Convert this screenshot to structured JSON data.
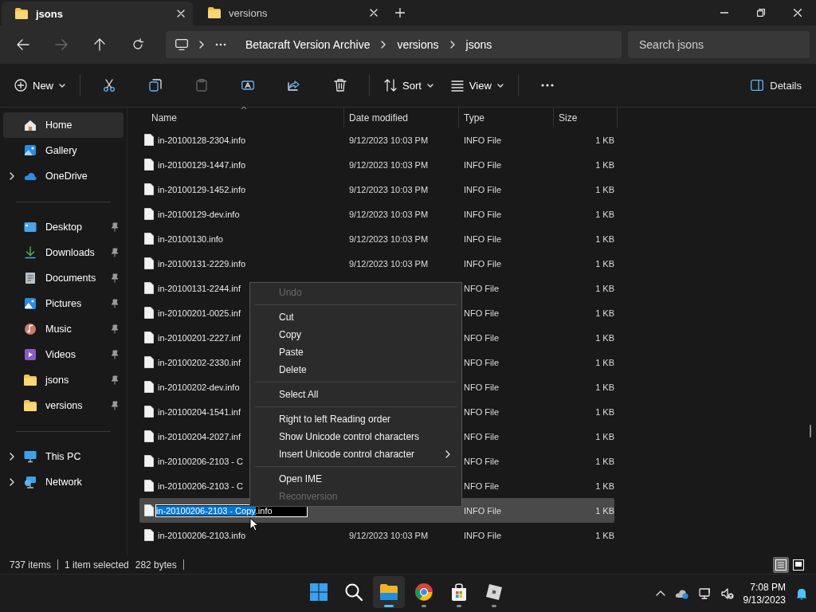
{
  "tabs": [
    {
      "label": "jsons",
      "selected": true
    },
    {
      "label": "versions",
      "selected": false
    }
  ],
  "address_bar": {
    "breadcrumbs": [
      "Betacraft Version Archive",
      "versions",
      "jsons"
    ],
    "search": {
      "placeholder": "Search jsons"
    }
  },
  "toolbar": {
    "items": [
      {
        "kind": "button",
        "label": "New",
        "dropdown": true,
        "disabled": false
      },
      {
        "kind": "separator"
      },
      {
        "kind": "button",
        "disabled": false
      },
      {
        "kind": "button",
        "disabled": false
      },
      {
        "kind": "button",
        "disabled": true
      },
      {
        "kind": "button",
        "disabled": false
      },
      {
        "kind": "button",
        "disabled": false
      },
      {
        "kind": "button",
        "disabled": false
      },
      {
        "kind": "separator"
      },
      {
        "kind": "button",
        "label": "Sort",
        "dropdown": true,
        "disabled": false
      },
      {
        "kind": "button",
        "label": "View",
        "dropdown": true,
        "disabled": false
      },
      {
        "kind": "separator"
      },
      {
        "kind": "button",
        "disabled": false
      }
    ],
    "details_button": {
      "label": "Details"
    }
  },
  "sidebar": {
    "groups": [
      [
        {
          "label": "Home",
          "kind": "plain",
          "selected": true
        },
        {
          "label": "Gallery",
          "kind": "plain",
          "selected": false
        },
        {
          "label": "OneDrive",
          "kind": "expandable",
          "selected": false
        }
      ],
      [
        {
          "label": "Desktop",
          "kind": "pinned",
          "selected": false
        },
        {
          "label": "Downloads",
          "kind": "pinned",
          "selected": false
        },
        {
          "label": "Documents",
          "kind": "pinned",
          "selected": false
        },
        {
          "label": "Pictures",
          "kind": "pinned",
          "selected": false
        },
        {
          "label": "Music",
          "kind": "pinned",
          "selected": false
        },
        {
          "label": "Videos",
          "kind": "pinned",
          "selected": false
        },
        {
          "label": "jsons",
          "kind": "pinned",
          "selected": false
        },
        {
          "label": "versions",
          "kind": "pinned",
          "selected": false
        }
      ],
      [
        {
          "label": "This PC",
          "kind": "expandable",
          "selected": false
        },
        {
          "label": "Network",
          "kind": "expandable",
          "selected": false
        }
      ]
    ]
  },
  "file_list": {
    "columns": [
      "Name",
      "Date modified",
      "Type",
      "Size"
    ],
    "rows": [
      {
        "name": "in-20100128-2304.info",
        "date": "9/12/2023 10:03 PM",
        "type": "INFO File",
        "size": "1 KB",
        "selected": false
      },
      {
        "name": "in-20100129-1447.info",
        "date": "9/12/2023 10:03 PM",
        "type": "INFO File",
        "size": "1 KB",
        "selected": false
      },
      {
        "name": "in-20100129-1452.info",
        "date": "9/12/2023 10:03 PM",
        "type": "INFO File",
        "size": "1 KB",
        "selected": false
      },
      {
        "name": "in-20100129-dev.info",
        "date": "9/12/2023 10:03 PM",
        "type": "INFO File",
        "size": "1 KB",
        "selected": false
      },
      {
        "name": "in-20100130.info",
        "date": "9/12/2023 10:03 PM",
        "type": "INFO File",
        "size": "1 KB",
        "selected": false
      },
      {
        "name": "in-20100131-2229.info",
        "date": "9/12/2023 10:03 PM",
        "type": "INFO File",
        "size": "1 KB",
        "selected": false
      },
      {
        "name": "in-20100131-2244.inf",
        "type": "NFO File",
        "size": "1 KB",
        "selected": false
      },
      {
        "name": "in-20100201-0025.inf",
        "type": "NFO File",
        "size": "1 KB",
        "selected": false
      },
      {
        "name": "in-20100201-2227.inf",
        "type": "NFO File",
        "size": "1 KB",
        "selected": false
      },
      {
        "name": "in-20100202-2330.inf",
        "type": "NFO File",
        "size": "1 KB",
        "selected": false
      },
      {
        "name": "in-20100202-dev.info",
        "type": "NFO File",
        "size": "1 KB",
        "selected": false
      },
      {
        "name": "in-20100204-1541.inf",
        "type": "NFO File",
        "size": "1 KB",
        "selected": false
      },
      {
        "name": "in-20100204-2027.inf",
        "type": "NFO File",
        "size": "1 KB",
        "selected": false
      },
      {
        "name": "in-20100206-2103 - C",
        "type": "NFO File",
        "size": "1 KB",
        "selected": false
      },
      {
        "name": "in-20100206-2103 - C",
        "type": "NFO File",
        "size": "1 KB",
        "selected": false
      },
      {
        "rename": {
          "highlighted": "in-20100206-2103 - Copy",
          "rest": ".info"
        },
        "type": "INFO File",
        "size": "1 KB",
        "selected": true
      },
      {
        "name": "in-20100206-2103.info",
        "date": "9/12/2023 10:03 PM",
        "type": "INFO File",
        "size": "1 KB",
        "selected": false
      }
    ]
  },
  "context_menu": {
    "items": [
      {
        "kind": "item",
        "label": "Undo",
        "disabled": true,
        "submenu": false
      },
      {
        "kind": "separator"
      },
      {
        "kind": "item",
        "label": "Cut",
        "disabled": false,
        "submenu": false
      },
      {
        "kind": "item",
        "label": "Copy",
        "disabled": false,
        "submenu": false
      },
      {
        "kind": "item",
        "label": "Paste",
        "disabled": false,
        "submenu": false
      },
      {
        "kind": "item",
        "label": "Delete",
        "disabled": false,
        "submenu": false
      },
      {
        "kind": "separator"
      },
      {
        "kind": "item",
        "label": "Select All",
        "disabled": false,
        "submenu": false
      },
      {
        "kind": "separator"
      },
      {
        "kind": "item",
        "label": "Right to left Reading order",
        "disabled": false,
        "submenu": false
      },
      {
        "kind": "item",
        "label": "Show Unicode control characters",
        "disabled": false,
        "submenu": false
      },
      {
        "kind": "item",
        "label": "Insert Unicode control character",
        "disabled": false,
        "submenu": true
      },
      {
        "kind": "separator"
      },
      {
        "kind": "item",
        "label": "Open IME",
        "disabled": false,
        "submenu": false
      },
      {
        "kind": "item",
        "label": "Reconversion",
        "disabled": true,
        "submenu": false
      }
    ]
  },
  "status_bar": {
    "item_count": "737 items",
    "selection": "1 item selected",
    "selection_size": "282 bytes",
    "view_toggles": [
      {
        "selected": true
      },
      {
        "selected": false
      }
    ]
  },
  "taskbar": {
    "apps": [
      {
        "active": false,
        "running": false
      },
      {
        "active": false,
        "running": false
      },
      {
        "active": true,
        "running": true
      },
      {
        "active": false,
        "running": true
      },
      {
        "active": false,
        "running": true
      },
      {
        "active": false,
        "running": true
      }
    ],
    "time": "7:08 PM",
    "date": "9/13/2023"
  }
}
